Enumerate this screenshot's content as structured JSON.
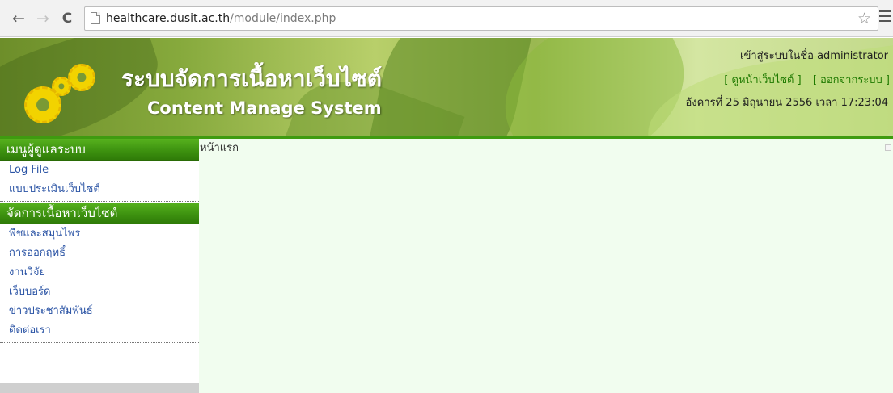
{
  "browser": {
    "url_host": "healthcare.dusit.ac.th",
    "url_path": "/module/index.php",
    "back_icon": "←",
    "forward_icon": "→",
    "reload_icon": "C",
    "star_icon": "☆"
  },
  "header": {
    "title": "ระบบจัดการเนื้อหาเว็บไซต์",
    "subtitle": "Content Manage System",
    "logged_in": "เข้าสู่ระบบในชื่อ administrator",
    "view_site": "[ ดูหน้าเว็บไซต์ ]",
    "logout": "[ ออกจากระบบ ]",
    "datetime": "อังคารที่ 25 มิถุนายน 2556 เวลา 17:23:04"
  },
  "sidebar": {
    "admin_menu": {
      "title": "เมนูผู้ดูแลระบบ",
      "items": [
        "Log File",
        "แบบประเมินเว็บไซต์"
      ]
    },
    "content_menu": {
      "title": "จัดการเนื้อหาเว็บไซต์",
      "items": [
        "พืชและสมุนไพร",
        "การออกฤทธิ์",
        "งานวิจัย",
        "เว็บบอร์ด",
        "ข่าวประชาสัมพันธ์",
        "ติดต่อเรา"
      ]
    }
  },
  "main": {
    "breadcrumb": "หน้าแรก"
  },
  "colors": {
    "menu_green": "#3e9310",
    "link_blue": "#2b54a5",
    "content_bg": "#f1fdef"
  }
}
